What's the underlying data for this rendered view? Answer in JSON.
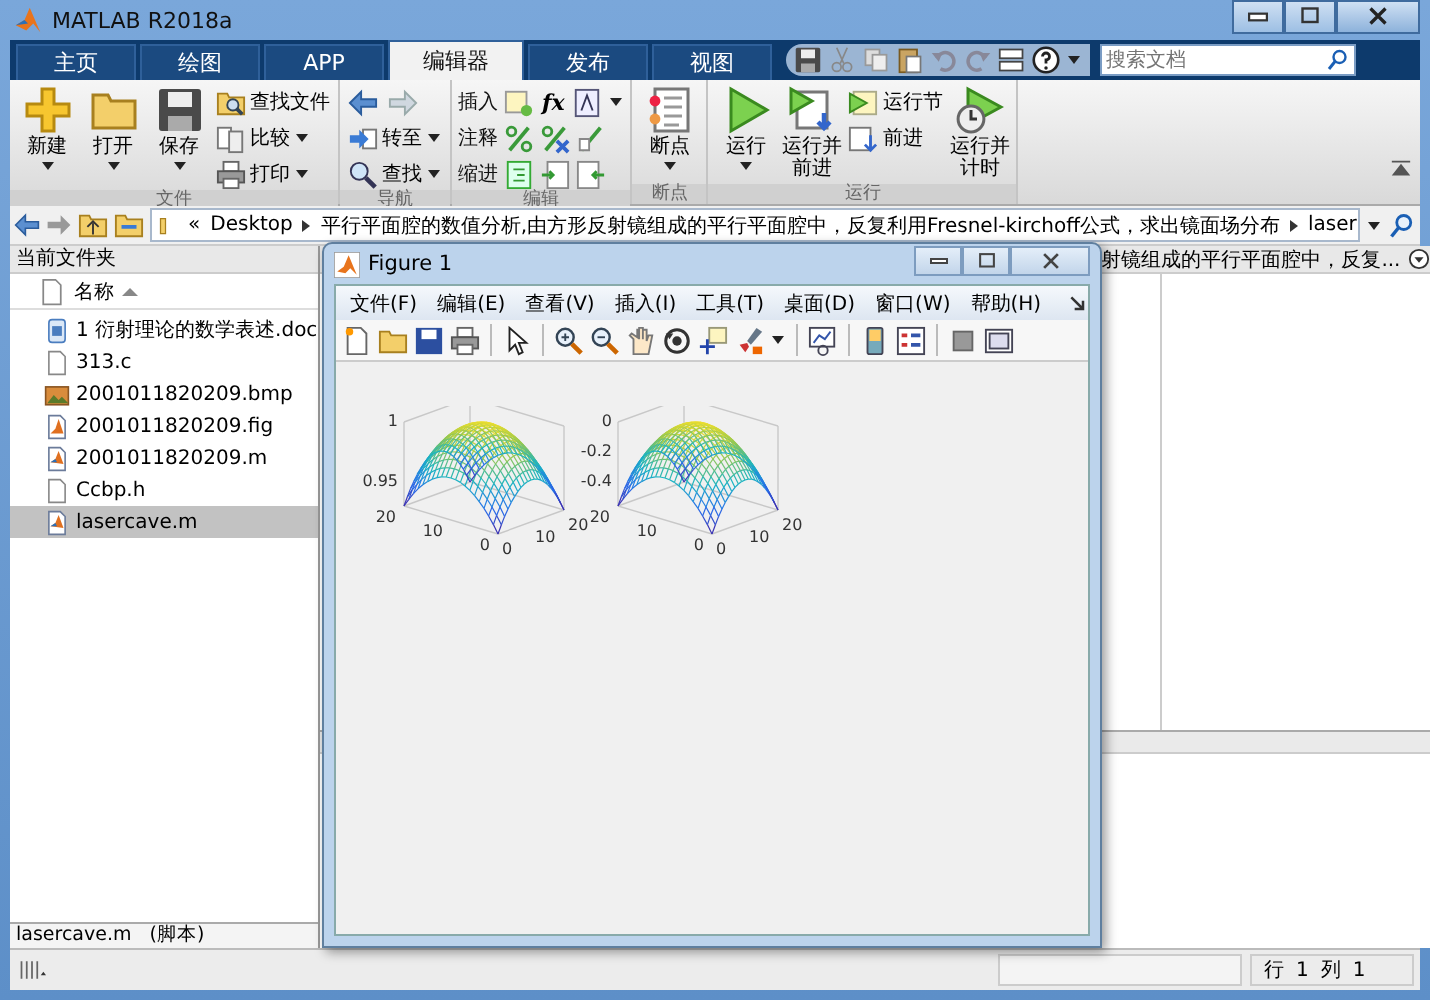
{
  "window": {
    "title": "MATLAB R2018a"
  },
  "tabs": [
    {
      "label": "主页",
      "selected": false
    },
    {
      "label": "绘图",
      "selected": false
    },
    {
      "label": "APP",
      "selected": false
    },
    {
      "label": "编辑器",
      "selected": true
    },
    {
      "label": "发布",
      "selected": false
    },
    {
      "label": "视图",
      "selected": false
    }
  ],
  "search": {
    "placeholder": "搜索文档"
  },
  "toolstrip": [
    {
      "label": "文件",
      "items": [
        {
          "kind": "large",
          "label": "新建",
          "dropdown": true
        },
        {
          "kind": "large",
          "label": "打开",
          "dropdown": true
        },
        {
          "kind": "large",
          "label": "保存",
          "dropdown": true
        },
        {
          "kind": "small",
          "label": "查找文件",
          "dropdown": false
        },
        {
          "kind": "small",
          "label": "比较",
          "dropdown": true
        },
        {
          "kind": "small",
          "label": "打印",
          "dropdown": true
        }
      ]
    },
    {
      "label": "导航",
      "items": [
        {
          "kind": "arrows"
        },
        {
          "kind": "small",
          "label": "转至",
          "dropdown": true
        },
        {
          "kind": "small",
          "label": "查找",
          "dropdown": true
        }
      ]
    },
    {
      "label": "编辑",
      "items": [
        {
          "kind": "icon-row",
          "label": "插入",
          "symbol": "fx",
          "dropdown": true
        },
        {
          "kind": "icon-row",
          "label": "注释",
          "dropdown": false
        },
        {
          "kind": "icon-row",
          "label": "缩进",
          "dropdown": false
        }
      ]
    },
    {
      "label": "断点",
      "items": [
        {
          "kind": "large",
          "label": "断点",
          "dropdown": true
        }
      ]
    },
    {
      "label": "运行",
      "items": [
        {
          "kind": "large",
          "label": "运行",
          "dropdown": true
        },
        {
          "kind": "large",
          "label": "运行并前进",
          "dropdown": false
        },
        {
          "kind": "small",
          "label": "运行节",
          "dropdown": false
        },
        {
          "kind": "small",
          "label": "前进",
          "dropdown": false
        },
        {
          "kind": "large",
          "label": "运行并计时",
          "dropdown": false
        }
      ]
    }
  ],
  "address_bar": {
    "overflow": "«",
    "path": [
      "Desktop",
      "平行平面腔的数值分析,由方形反射镜组成的平行平面腔中，反复利用Fresnel-kirchoff公式，求出镜面场分布",
      "laser"
    ]
  },
  "current_folder": {
    "title": "当前文件夹",
    "column": "名称",
    "files": [
      {
        "name": "1 衍射理论的数学表述.doc",
        "kind": "doc",
        "selected": false
      },
      {
        "name": "313.c",
        "kind": "text",
        "selected": false
      },
      {
        "name": "2001011820209.bmp",
        "kind": "image",
        "selected": false
      },
      {
        "name": "2001011820209.fig",
        "kind": "figure",
        "selected": false
      },
      {
        "name": "2001011820209.m",
        "kind": "script",
        "selected": false
      },
      {
        "name": "Ccbp.h",
        "kind": "text",
        "selected": false
      },
      {
        "name": "lasercave.m",
        "kind": "script",
        "selected": true
      }
    ],
    "details": {
      "name": "lasercave.m",
      "type": "(脚本)"
    }
  },
  "editor": {
    "tab_title": "射镜组成的平行平面腔中，反复..."
  },
  "figure": {
    "title": "Figure 1",
    "menu": [
      "文件(F)",
      "编辑(E)",
      "查看(V)",
      "插入(I)",
      "工具(T)",
      "桌面(D)",
      "窗口(W)",
      "帮助(H)"
    ],
    "plots": [
      {
        "zticks": [
          "1",
          "0.95"
        ],
        "yticks": [
          "20",
          "10",
          "0"
        ],
        "xticks": [
          "0",
          "10",
          "20"
        ]
      },
      {
        "zticks": [
          "0",
          "-0.2",
          "-0.4"
        ],
        "yticks": [
          "20",
          "10",
          "0"
        ],
        "xticks": [
          "0",
          "10",
          "20"
        ]
      }
    ]
  },
  "status_bar": {
    "row_label": "行",
    "row": "1",
    "col_label": "列",
    "col": "1"
  }
}
